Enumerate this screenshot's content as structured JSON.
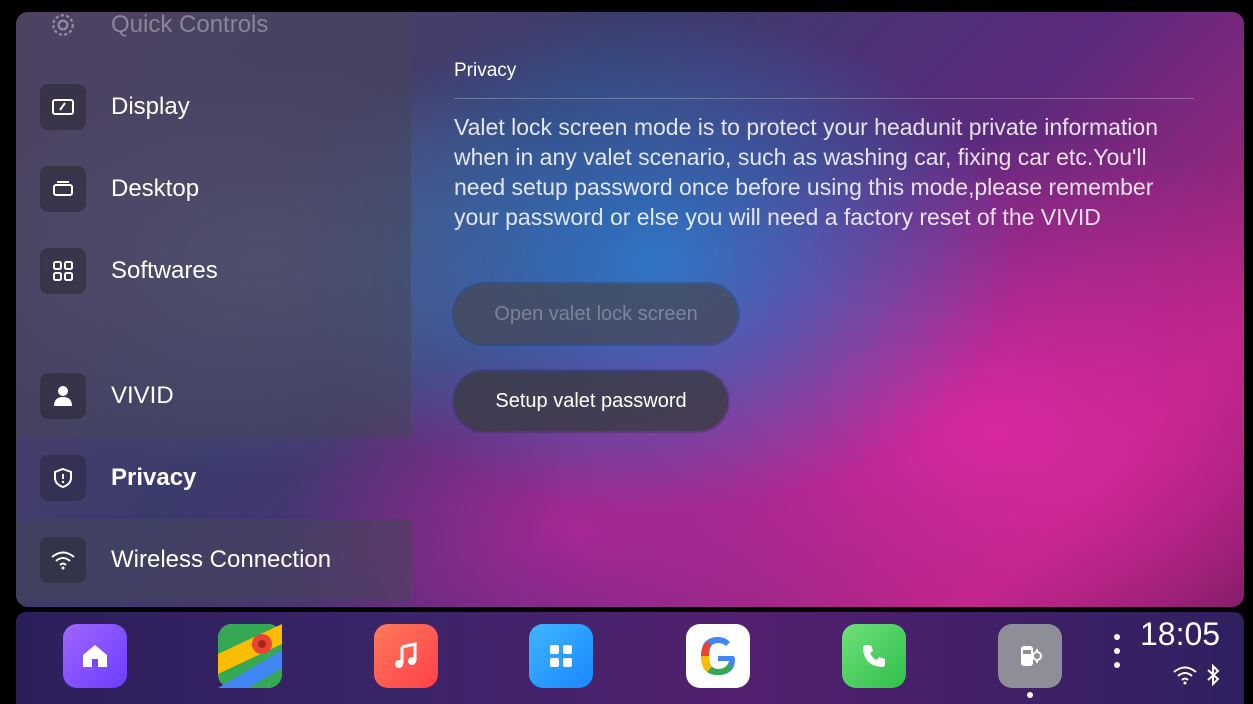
{
  "sidebar": {
    "items": [
      {
        "label": "Quick Controls",
        "icon": "gear-icon"
      },
      {
        "label": "Display",
        "icon": "display-icon"
      },
      {
        "label": "Desktop",
        "icon": "desktop-icon"
      },
      {
        "label": "Softwares",
        "icon": "grid-icon"
      },
      {
        "label": "VIVID",
        "icon": "person-icon"
      },
      {
        "label": "Privacy",
        "icon": "shield-icon"
      },
      {
        "label": "Wireless Connection",
        "icon": "wifi-icon"
      }
    ],
    "selected": "Privacy"
  },
  "main": {
    "title": "Privacy",
    "description": "Valet lock screen mode is to protect your headunit private information when in any valet scenario, such as washing car, fixing car etc.You'll need setup password once before using this mode,please remember your password or else you will need a factory reset of the VIVID",
    "open_button": "Open valet lock screen",
    "setup_button": "Setup valet password"
  },
  "dock": {
    "apps": [
      "home-icon",
      "maps-icon",
      "music-icon",
      "apps-grid-icon",
      "google-icon",
      "phone-icon",
      "car-settings-icon"
    ],
    "time": "18:05"
  },
  "colors": {
    "home": "#8a4bff",
    "music": "#ff5a4a",
    "apps": "#2aa0ff",
    "phone": "#4cd964",
    "car": "#8e8e98"
  }
}
